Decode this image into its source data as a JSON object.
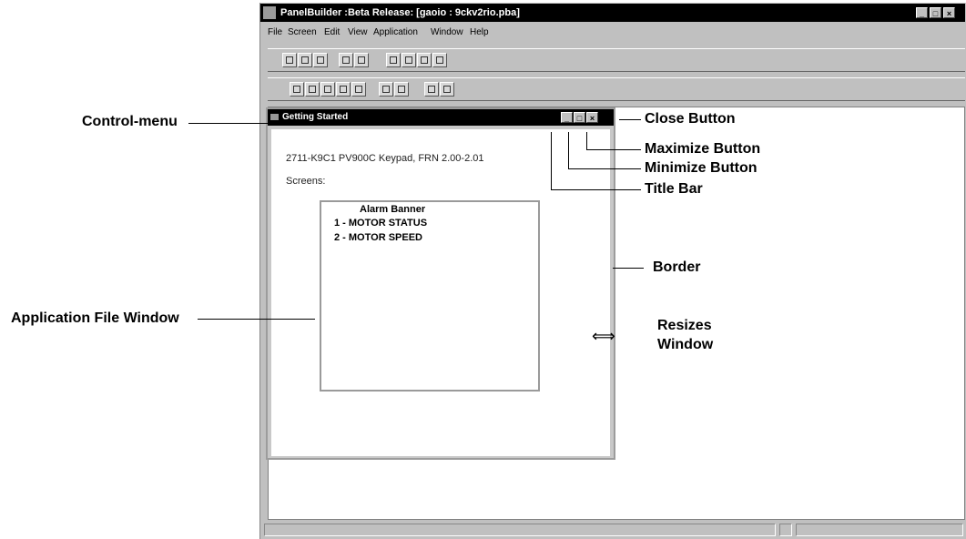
{
  "app": {
    "title": "PanelBuilder :Beta Release: [gaoio : 9ckv2rio.pba]",
    "menu": [
      "File",
      "Screen",
      "Edit",
      "View",
      "Application",
      "Window",
      "Help"
    ]
  },
  "child_window": {
    "title": "Getting Started",
    "device_line": "2711-K9C1   PV900C Keypad, FRN 2.00-2.01",
    "screens_label": "Screens:",
    "screens": [
      "Alarm Banner",
      "1 - MOTOR STATUS",
      "2 - MOTOR SPEED"
    ]
  },
  "callouts": {
    "control_menu": "Control-menu",
    "application_file_window": "Application File Window",
    "close_button": "Close Button",
    "maximize_button": "Maximize Button",
    "minimize_button": "Minimize Button",
    "title_bar": "Title Bar",
    "border": "Border",
    "resizes_line1": "Resizes",
    "resizes_line2": "Window",
    "resize_arrow": "⟺"
  }
}
